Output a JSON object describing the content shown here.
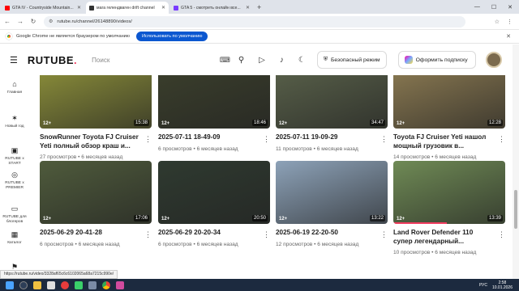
{
  "browser": {
    "tabs": [
      {
        "title": "GTA IV - Countryside Mountain...",
        "favicon_color": "#ff0000",
        "active": false
      },
      {
        "title": "мага гелендваген drift channel",
        "favicon_color": "#333333",
        "active": true
      },
      {
        "title": "GTA 5 - смотреть онлайн все...",
        "favicon_color": "#7a3cff",
        "active": false
      }
    ],
    "url": "rutube.ru/channel/26148890/videos/",
    "infobar_text": "Google Chrome не является браузером по умолчанию",
    "infobar_button": "Использовать по умолчанию",
    "status_url": "https://rutube.ru/video/3328af65c6c6102065a68a7215c990e/"
  },
  "header": {
    "logo": "RUTUBE",
    "search_placeholder": "Поиск",
    "safe_mode": "Безопасный режим",
    "subscribe": "Оформить подписку"
  },
  "sidebar": [
    {
      "label": "Главная",
      "icon": "home-icon",
      "glyph": "⌂"
    },
    {
      "label": "Новый год",
      "icon": "tree-icon",
      "glyph": "✶"
    },
    {
      "label": "RUTUBE x START",
      "icon": "start-icon",
      "glyph": "▣"
    },
    {
      "label": "RUTUBE x PREMIER",
      "icon": "premier-icon",
      "glyph": "◎"
    },
    {
      "label": "RUTUBE для блогеров",
      "icon": "blogger-icon",
      "glyph": "▭"
    },
    {
      "label": "Каталог",
      "icon": "catalog-icon",
      "glyph": "▦"
    },
    {
      "label": "В топе",
      "icon": "top-icon",
      "glyph": "⚑"
    }
  ],
  "videos": [
    {
      "title": "SnowRunner Toyota FJ Cruiser Yeti полный обзор краш и...",
      "views": "27 просмотров",
      "ago": "6 месяцев назад",
      "duration": "15:38",
      "age": "12+",
      "bg": "#8c8f3a",
      "progress": 0
    },
    {
      "title": "2025-07-11 18-49-09",
      "views": "6 просмотров",
      "ago": "6 месяцев назад",
      "duration": "18:46",
      "age": "12+",
      "bg": "#3b3f2c",
      "progress": 0
    },
    {
      "title": "2025-07-11 19-09-29",
      "views": "11 просмотров",
      "ago": "6 месяцев назад",
      "duration": "34:47",
      "age": "12+",
      "bg": "#59614a",
      "progress": 0
    },
    {
      "title": "Toyota FJ Cruiser Yeti нашол мощный грузовик в...",
      "views": "14 просмотров",
      "ago": "6 месяцев назад",
      "duration": "12:28",
      "age": "12+",
      "bg": "#8b7a52",
      "progress": 0
    },
    {
      "title": "2025-06-29 20-41-28",
      "views": "6 просмотров",
      "ago": "6 месяцев назад",
      "duration": "17:06",
      "age": "12+",
      "bg": "#4f5b3c",
      "progress": 0
    },
    {
      "title": "2025-06-29 20-20-34",
      "views": "6 просмотров",
      "ago": "6 месяцев назад",
      "duration": "20:50",
      "age": "12+",
      "bg": "#2f3a30",
      "progress": 0
    },
    {
      "title": "2025-06-19 22-20-50",
      "views": "12 просмотров",
      "ago": "6 месяцев назад",
      "duration": "13:22",
      "age": "12+",
      "bg": "#8da2b8",
      "progress": 0
    },
    {
      "title": "Land Rover Defender 110 супер легендарный...",
      "views": "10 просмотров",
      "ago": "6 месяцев назад",
      "duration": "13:39",
      "age": "12+",
      "bg": "#6f8a55",
      "progress": 0.48
    }
  ],
  "taskbar": {
    "time": "2:58",
    "date": "10.01.2026",
    "lang": "РУС"
  }
}
